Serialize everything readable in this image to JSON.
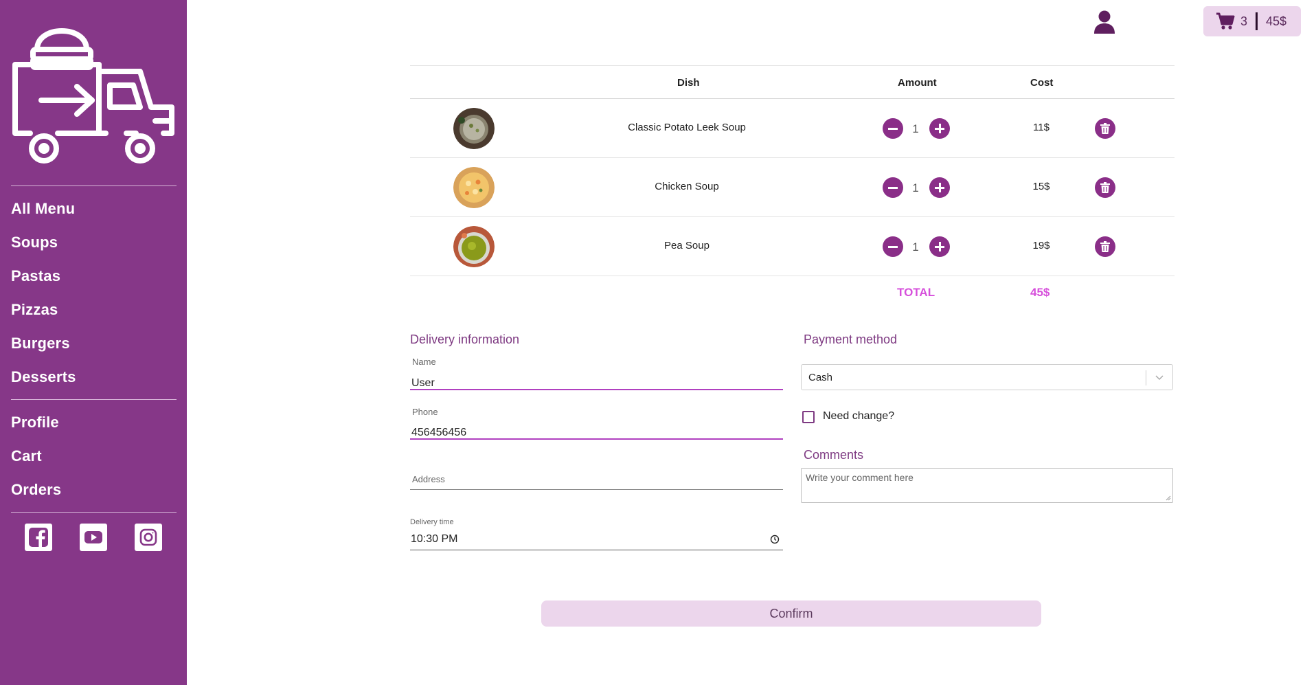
{
  "sidebar": {
    "nav": [
      {
        "label": "All Menu"
      },
      {
        "label": "Soups"
      },
      {
        "label": "Pastas"
      },
      {
        "label": "Pizzas"
      },
      {
        "label": "Burgers"
      },
      {
        "label": "Desserts"
      }
    ],
    "account": [
      {
        "label": "Profile"
      },
      {
        "label": "Cart"
      },
      {
        "label": "Orders"
      }
    ],
    "social": [
      "facebook-icon",
      "youtube-icon",
      "instagram-icon"
    ],
    "logo_icon": "delivery-truck-logo-icon"
  },
  "header": {
    "cart_count": "3",
    "cart_total": "45$",
    "profile_icon": "user-icon",
    "cart_icon": "cart-icon"
  },
  "table": {
    "columns": {
      "dish": "Dish",
      "amount": "Amount",
      "cost": "Cost"
    },
    "rows": [
      {
        "name": "Classic Potato Leek Soup",
        "qty": "1",
        "cost": "11$"
      },
      {
        "name": "Chicken Soup",
        "qty": "1",
        "cost": "15$"
      },
      {
        "name": "Pea Soup",
        "qty": "1",
        "cost": "19$"
      }
    ],
    "total_label": "TOTAL",
    "total_value": "45$"
  },
  "delivery": {
    "title": "Delivery information",
    "name_label": "Name",
    "name_value": "User",
    "phone_label": "Phone",
    "phone_value": "456456456",
    "address_label": "Address",
    "time_label": "Delivery time",
    "time_value": "10:30 PM"
  },
  "payment": {
    "title": "Payment method",
    "selected": "Cash",
    "need_change": "Need change?",
    "comments_title": "Comments",
    "comments_placeholder": "Write your comment here"
  },
  "confirm_label": "Confirm",
  "colors": {
    "sidebar": "#863788",
    "accent": "#8a2e88",
    "total": "#d64fdb",
    "button_bg": "#ecd6ec"
  }
}
